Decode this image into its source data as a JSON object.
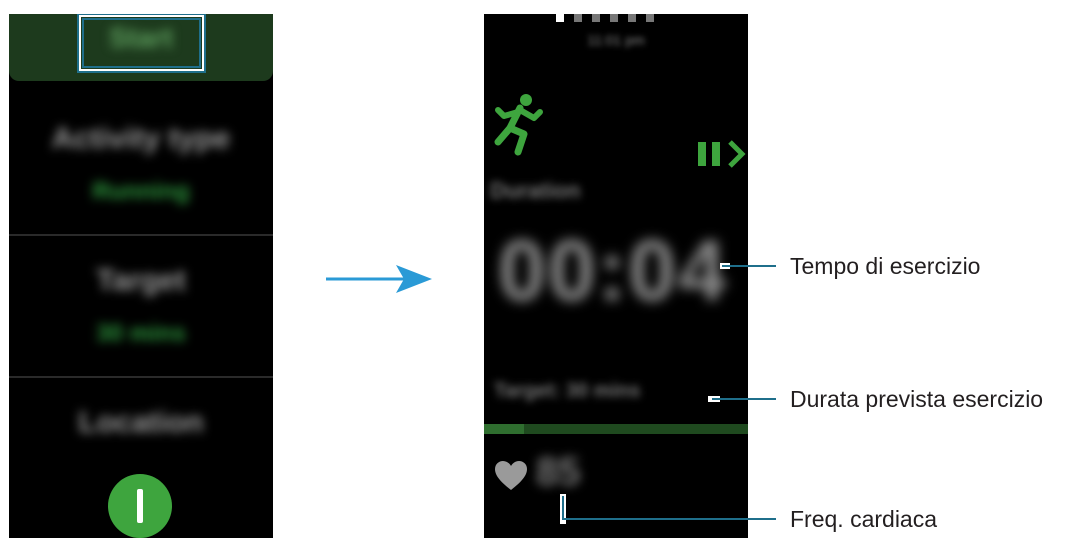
{
  "left_screen": {
    "start_label": "Start",
    "menu": [
      {
        "label": "Activity type",
        "value": "Running"
      },
      {
        "label": "Target",
        "value": "30 mins"
      },
      {
        "label": "Location",
        "value": ""
      }
    ]
  },
  "right_screen": {
    "time": "11:01 pm",
    "duration_label": "Duration",
    "timer": "00:04",
    "target_text": "Target: 30 mins",
    "target_progress_fraction": 0.15,
    "heart_rate": "85",
    "accent_color": "#3ea53e"
  },
  "callouts": {
    "exercise_time": "Tempo di esercizio",
    "target_duration": "Durata prevista esercizio",
    "heart_rate": "Freq. cardiaca"
  },
  "icons": [
    "running-icon",
    "pause-icon",
    "chevron-right-icon",
    "heart-icon",
    "arrow-right-icon",
    "toggle-icon"
  ]
}
